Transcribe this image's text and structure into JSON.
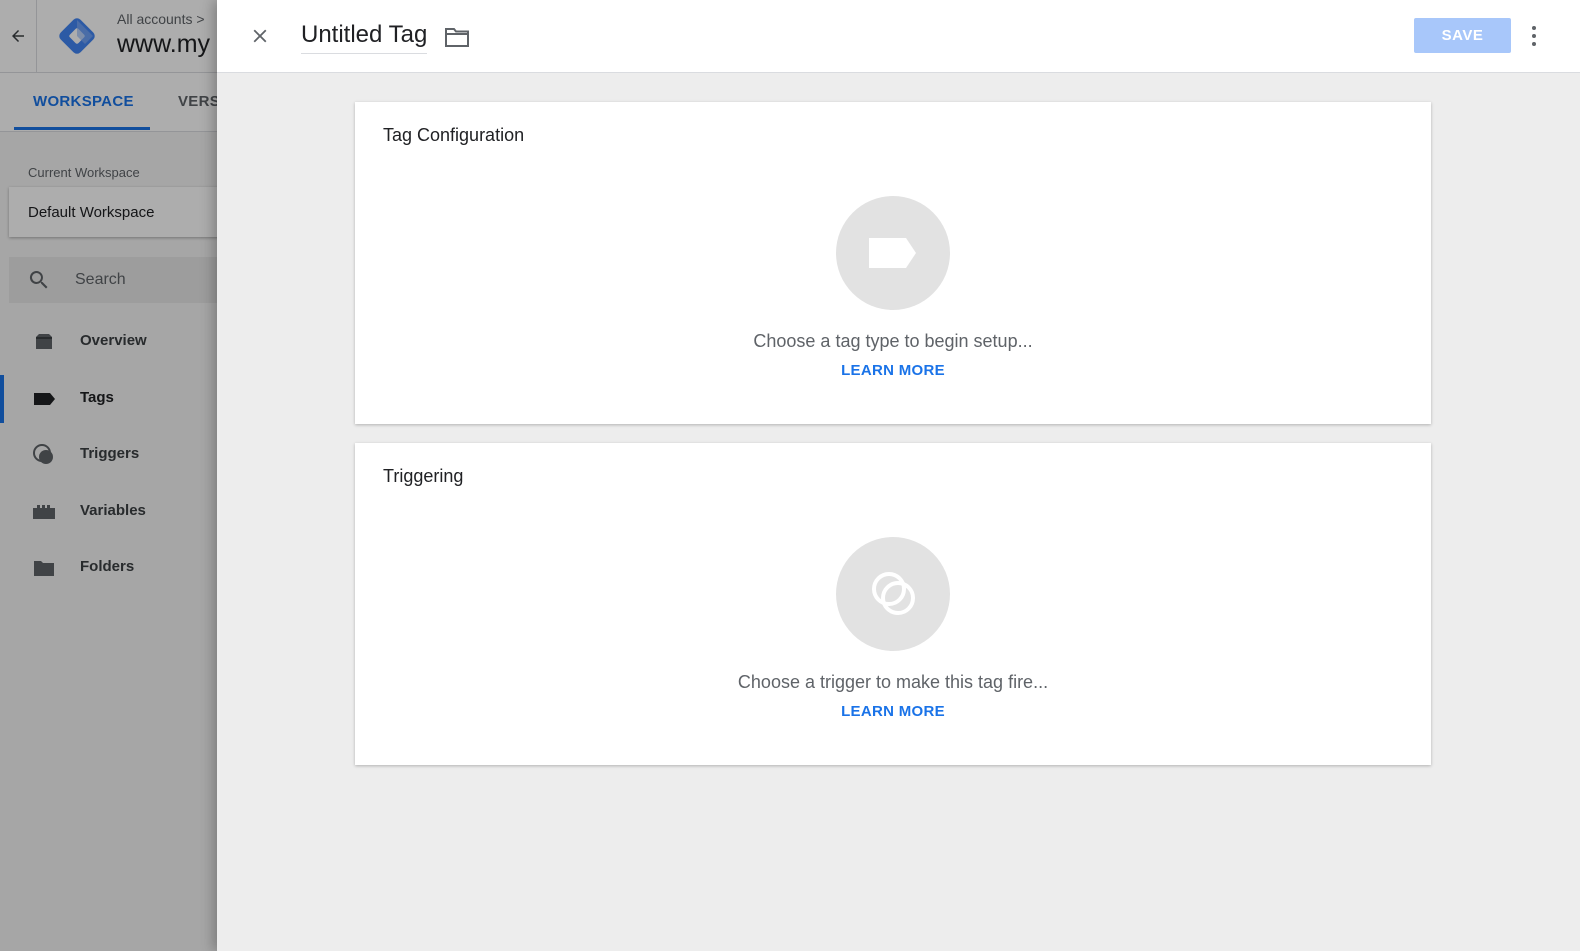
{
  "app": {
    "breadcrumb": "All accounts  >",
    "container_name": "www.my",
    "tabs": [
      "WORKSPACE",
      "VERS"
    ],
    "current_workspace_label": "Current Workspace",
    "current_workspace_value": "Default Workspace",
    "search_placeholder": "Search",
    "nav": [
      {
        "label": "Overview",
        "icon": "overview-icon"
      },
      {
        "label": "Tags",
        "icon": "tag-icon"
      },
      {
        "label": "Triggers",
        "icon": "trigger-icon"
      },
      {
        "label": "Variables",
        "icon": "variables-icon"
      },
      {
        "label": "Folders",
        "icon": "folder-icon"
      }
    ],
    "active_nav": "Tags"
  },
  "panel": {
    "title": "Untitled Tag",
    "save_label": "SAVE",
    "cards": [
      {
        "title": "Tag Configuration",
        "prompt": "Choose a tag type to begin setup...",
        "link": "LEARN MORE",
        "icon": "tag-icon"
      },
      {
        "title": "Triggering",
        "prompt": "Choose a trigger to make this tag fire...",
        "link": "LEARN MORE",
        "icon": "trigger-icon"
      }
    ]
  },
  "colors": {
    "accent": "#1a73e8",
    "save_disabled": "#a8c7fa",
    "panel_bg": "#ededed"
  }
}
